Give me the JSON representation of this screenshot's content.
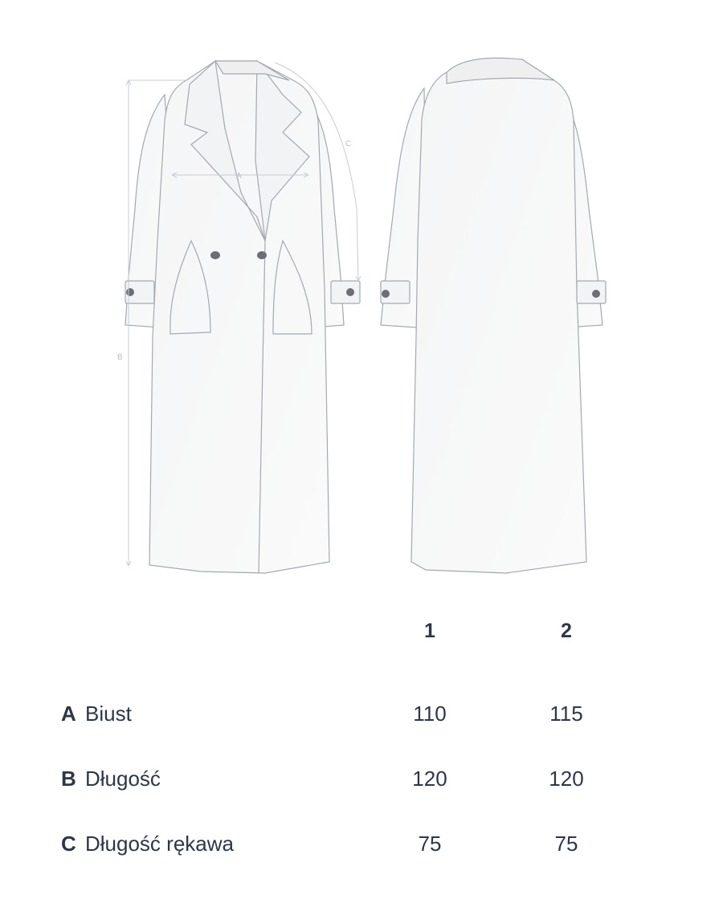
{
  "diagram": {
    "labels": {
      "a": "A",
      "b": "B",
      "c": "C"
    }
  },
  "table": {
    "columns": [
      "1",
      "2"
    ],
    "rows": [
      {
        "code": "A",
        "name": "Biust",
        "values": [
          "110",
          "115"
        ]
      },
      {
        "code": "B",
        "name": "Długość",
        "values": [
          "120",
          "120"
        ]
      },
      {
        "code": "C",
        "name": "Długość rękawa",
        "values": [
          "75",
          "75"
        ]
      }
    ]
  },
  "colors": {
    "text": "#2d3748",
    "outline": "#9aa0a6",
    "dimension": "#c8ccd2",
    "button": "#6b6f75"
  }
}
